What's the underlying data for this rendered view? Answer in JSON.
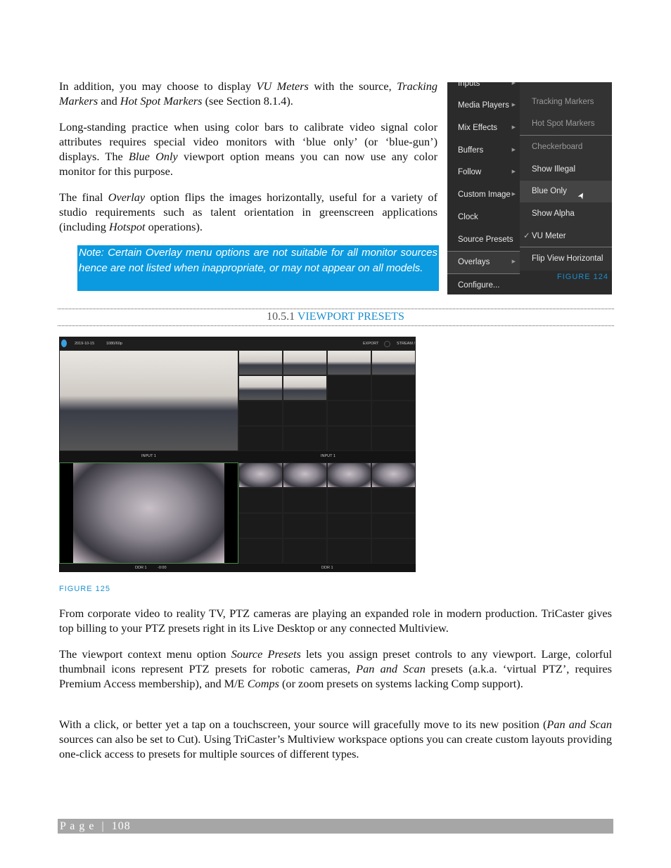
{
  "paragraphs_top": [
    {
      "segments": [
        [
          "In addition, you may choose to display ",
          ""
        ],
        [
          "VU Meters",
          "i"
        ],
        [
          " with the source, ",
          ""
        ],
        [
          "Tracking Markers",
          "i"
        ],
        [
          " and ",
          ""
        ],
        [
          "Hot Spot Markers",
          "i"
        ],
        [
          " (see Section 8.1.4).",
          ""
        ]
      ]
    },
    {
      "segments": [
        [
          "Long-standing practice when using color bars to calibrate video signal color attributes requires special video monitors with ‘blue only’ (or ‘blue-gun’) displays.  The ",
          ""
        ],
        [
          "Blue Only",
          "i"
        ],
        [
          " viewport option means you can now use any color monitor for this purpose.",
          ""
        ]
      ]
    },
    {
      "segments": [
        [
          "The final ",
          ""
        ],
        [
          "Overlay",
          "i"
        ],
        [
          " option flips the images horizontally, useful for a variety of studio requirements such as talent orientation in greenscreen applications (including ",
          ""
        ],
        [
          "Hotspot",
          "i"
        ],
        [
          " operations).",
          ""
        ]
      ]
    }
  ],
  "note": "Note: Certain Overlay menu options are not suitable for all monitor sources hence are not listed when inappropriate, or may  not appear on all models.",
  "menu": {
    "main_items": [
      {
        "label": "Inputs",
        "submenu": true
      },
      {
        "label": "Media Players",
        "submenu": true
      },
      {
        "label": "Mix Effects",
        "submenu": true
      },
      {
        "label": "Buffers",
        "submenu": true
      },
      {
        "label": "Follow",
        "submenu": true
      },
      {
        "label": "Custom Image",
        "submenu": true
      },
      {
        "label": "Clock",
        "submenu": false
      },
      {
        "label": "Source Presets",
        "submenu": false
      },
      {
        "label": "Overlays",
        "submenu": true,
        "active": true
      },
      {
        "label": "Configure...",
        "submenu": false
      }
    ],
    "sub_items": [
      {
        "label": "Tracking Markers",
        "disabled": true
      },
      {
        "label": "Hot Spot Markers",
        "disabled": true
      },
      {
        "label": "Checkerboard",
        "disabled": true
      },
      {
        "label": "Show Illegal"
      },
      {
        "label": "Blue Only",
        "hover": true
      },
      {
        "label": "Show Alpha"
      },
      {
        "label": "VU Meter",
        "checked": true
      },
      {
        "label": "Flip View Horizontal"
      }
    ],
    "check_mark": "✓"
  },
  "figure124": "FIGURE 124",
  "section": {
    "number": "10.5.1",
    "title": "VIEWPORT PRESETS"
  },
  "multiview": {
    "date": "2019-10-15",
    "format": "1080/60p",
    "export": "EXPORT",
    "stream": "STREAM /",
    "top_label_left": "INPUT 1",
    "top_label_right": "INPUT 1",
    "bottom_label_left": "DDR 1",
    "bottom_time": "-0:00",
    "bottom_label_right": "DDR 1"
  },
  "figure125": "FIGURE 125",
  "paragraphs_bottom": [
    {
      "segments": [
        [
          "From corporate video to reality TV, PTZ cameras are playing an expanded role in modern production. TriCaster gives top billing to your PTZ presets right in its Live Desktop or any connected Multiview.",
          ""
        ]
      ]
    },
    {
      "segments": [
        [
          "The viewport context menu option ",
          ""
        ],
        [
          "Source Presets",
          "i"
        ],
        [
          " lets you assign preset controls to any viewport. Large, colorful thumbnail icons represent PTZ presets for robotic cameras, ",
          ""
        ],
        [
          "Pan and Scan",
          "i"
        ],
        [
          " presets (a.k.a. ‘virtual PTZ’, requires Premium Access membership), and M/E ",
          ""
        ],
        [
          "Comps",
          "i"
        ],
        [
          " (or zoom presets on systems lacking Comp support).",
          ""
        ]
      ]
    },
    {
      "segments": [
        [
          "With a click, or better yet a tap on a touchscreen, your source will gracefully move to its new position (",
          ""
        ],
        [
          "Pan and Scan",
          "i"
        ],
        [
          " sources can also be set to Cut). Using TriCaster’s Multiview workspace options you can create custom layouts providing one-click access to presets for multiple sources of different types.",
          ""
        ]
      ]
    }
  ],
  "footer": {
    "label": "P a g e  |  ",
    "page": "108"
  },
  "colors": {
    "accent": "#1a8fd0",
    "note_bg": "#0b9ae0",
    "footer_bg": "#a6a6a6",
    "menu_bg": "#2b2b2b"
  }
}
